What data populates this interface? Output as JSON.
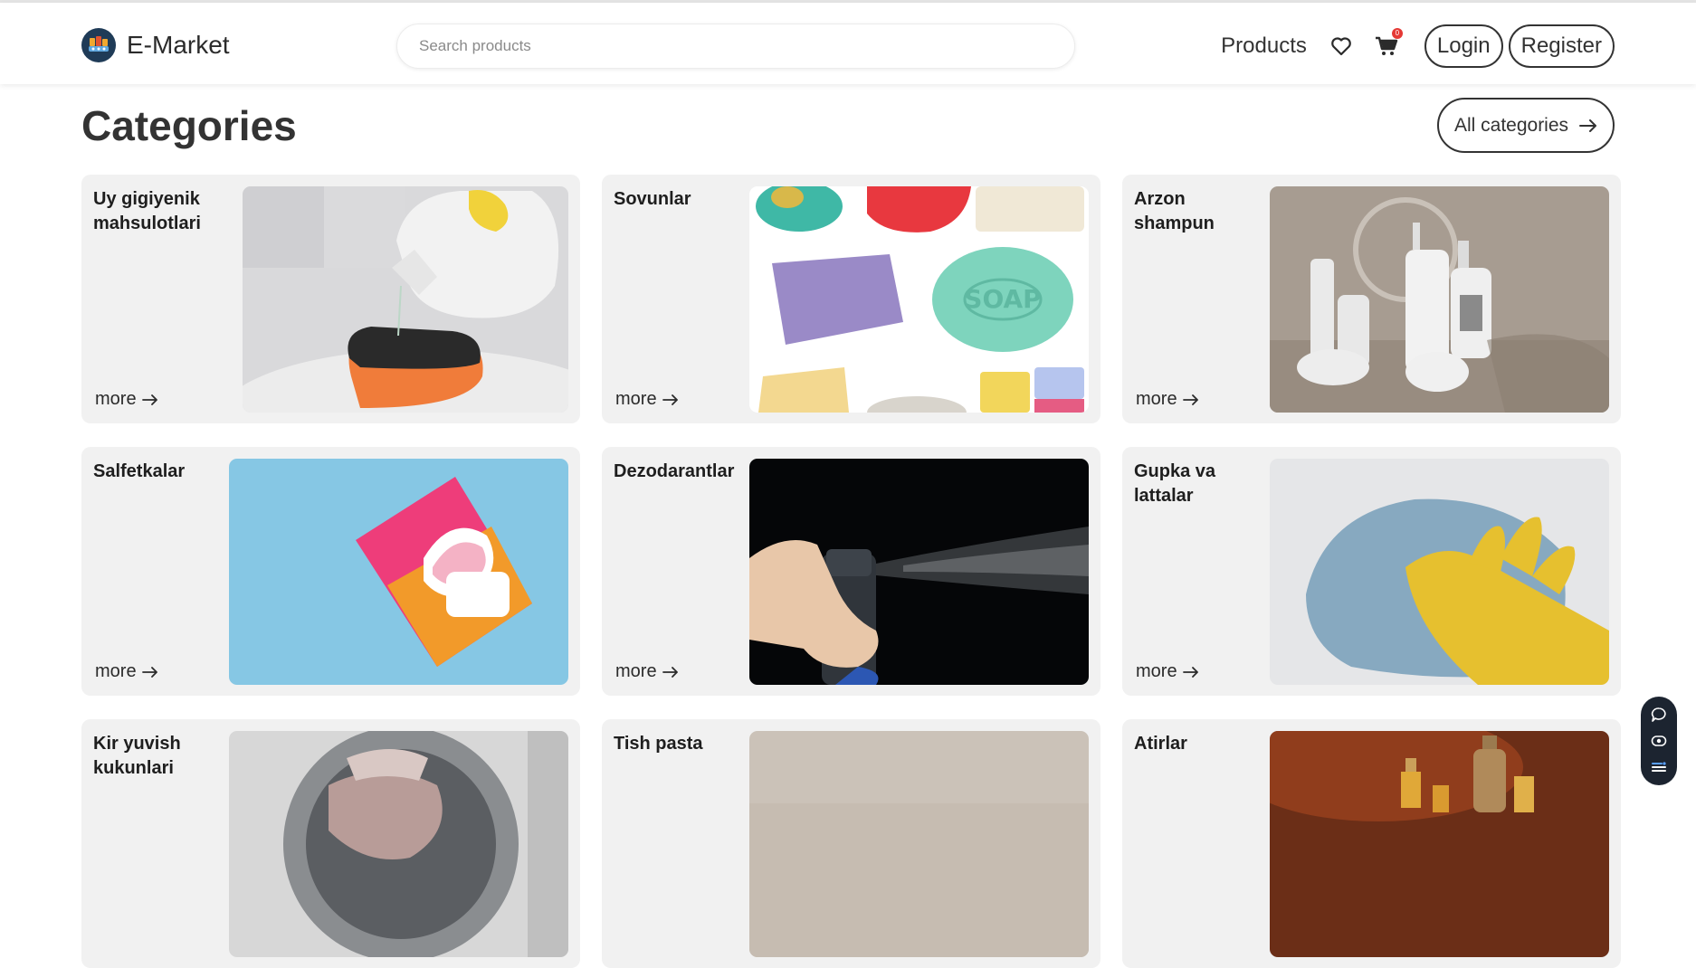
{
  "header": {
    "brand": "E-Market",
    "search_placeholder": "Search products",
    "nav_products": "Products",
    "cart_count": "0",
    "login_label": "Login",
    "register_label": "Register"
  },
  "section": {
    "title": "Categories",
    "all_label": "All categories"
  },
  "more_label": "more",
  "categories": [
    {
      "title": "Uy gigiyenik mahsulotlari"
    },
    {
      "title": "Sovunlar"
    },
    {
      "title": "Arzon shampun"
    },
    {
      "title": "Salfetkalar"
    },
    {
      "title": "Dezodarantlar"
    },
    {
      "title": "Gupka va lattalar"
    },
    {
      "title": "Kir yuvish kukunlari"
    },
    {
      "title": "Tish pasta"
    },
    {
      "title": "Atirlar"
    }
  ],
  "colors": {
    "card_bg": "#f1f1f1",
    "text": "#2b2b2b",
    "badge": "#e53935",
    "floating_bg": "#1c2430"
  },
  "icons": [
    "heart-icon",
    "cart-icon",
    "arrow-right-icon",
    "chat-icon",
    "eye-icon",
    "menu-icon"
  ]
}
